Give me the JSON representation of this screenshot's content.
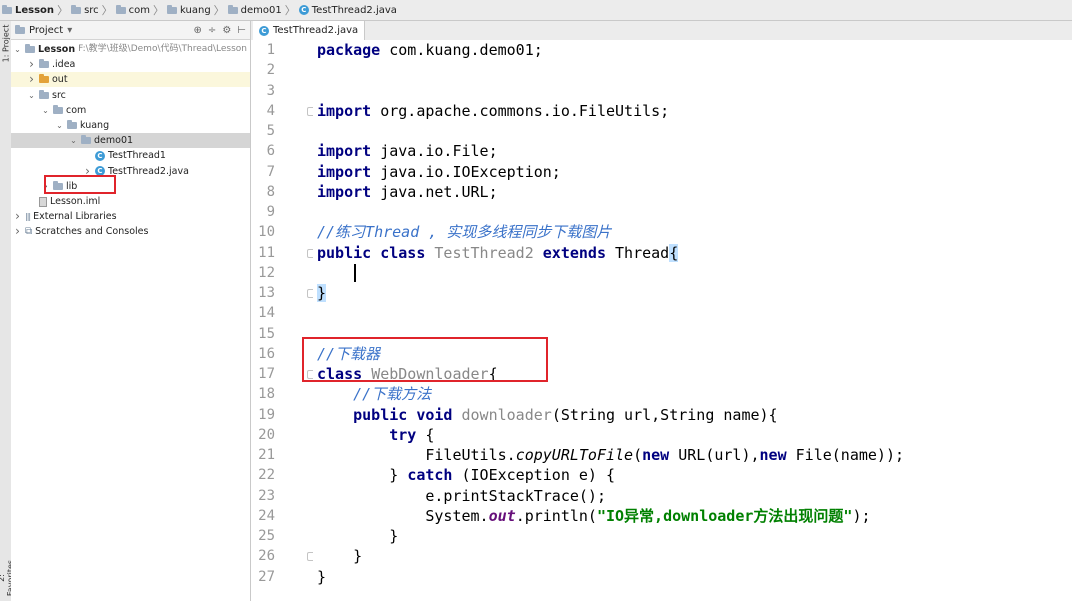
{
  "breadcrumb": [
    {
      "label": "Lesson",
      "icon": "folder-icon",
      "bold": true
    },
    {
      "label": "src",
      "icon": "folder-icon"
    },
    {
      "label": "com",
      "icon": "folder-icon"
    },
    {
      "label": "kuang",
      "icon": "folder-icon"
    },
    {
      "label": "demo01",
      "icon": "folder-icon"
    },
    {
      "label": "TestThread2.java",
      "icon": "java-class-icon"
    }
  ],
  "side_tabs": {
    "project": "1: Project",
    "favorites": "2: Favorites"
  },
  "project_panel": {
    "title": "Project",
    "dropdown": "▾",
    "toolbar_icons": [
      "target-icon",
      "collapse-icon",
      "gear-icon",
      "hide-icon"
    ],
    "tree": [
      {
        "label": "Lesson",
        "path": "F:\\教学\\班级\\Demo\\代码\\Thread\\Lesson",
        "depth": 0,
        "expanded": true,
        "icon": "folder",
        "bold": true
      },
      {
        "label": ".idea",
        "depth": 1,
        "expanded": false,
        "icon": "folder"
      },
      {
        "label": "out",
        "depth": 1,
        "expanded": false,
        "icon": "folder-orange"
      },
      {
        "label": "src",
        "depth": 1,
        "expanded": true,
        "icon": "folder"
      },
      {
        "label": "com",
        "depth": 2,
        "expanded": true,
        "icon": "folder"
      },
      {
        "label": "kuang",
        "depth": 3,
        "expanded": true,
        "icon": "folder"
      },
      {
        "label": "demo01",
        "depth": 4,
        "expanded": true,
        "icon": "folder",
        "selected": true
      },
      {
        "label": "TestThread1",
        "depth": 5,
        "icon": "class"
      },
      {
        "label": "TestThread2.java",
        "depth": 5,
        "expanded": false,
        "icon": "class"
      },
      {
        "label": "lib",
        "depth": 2,
        "expanded": false,
        "icon": "folder"
      },
      {
        "label": "Lesson.iml",
        "depth": 1,
        "icon": "file"
      },
      {
        "label": "External Libraries",
        "depth": 0,
        "expanded": false,
        "icon": "lib"
      },
      {
        "label": "Scratches and Consoles",
        "depth": 0,
        "expanded": false,
        "icon": "scratch"
      }
    ]
  },
  "editor": {
    "tab_label": "TestThread2.java",
    "lines": [
      "package com.kuang.demo01;",
      "",
      "",
      "import org.apache.commons.io.FileUtils;",
      "",
      "import java.io.File;",
      "import java.io.IOException;",
      "import java.net.URL;",
      "",
      "//练习Thread , 实现多线程同步下载图片",
      "public class TestThread2 extends Thread{",
      "",
      "}",
      "",
      "",
      "//下载器",
      "class WebDownloader{",
      "    //下载方法",
      "    public void downloader(String url,String name){",
      "        try {",
      "            FileUtils.copyURLToFile(new URL(url),new File(name));",
      "        } catch (IOException e) {",
      "            e.printStackTrace();",
      "            System.out.println(\"IO异常,downloader方法出现问题\");",
      "        }",
      "    }",
      "}"
    ]
  },
  "colors": {
    "keyword": "#000080",
    "comment": "#3a72c9",
    "string": "#008000",
    "highlight_box": "#e0242b",
    "caret_line": "#fffae3"
  }
}
